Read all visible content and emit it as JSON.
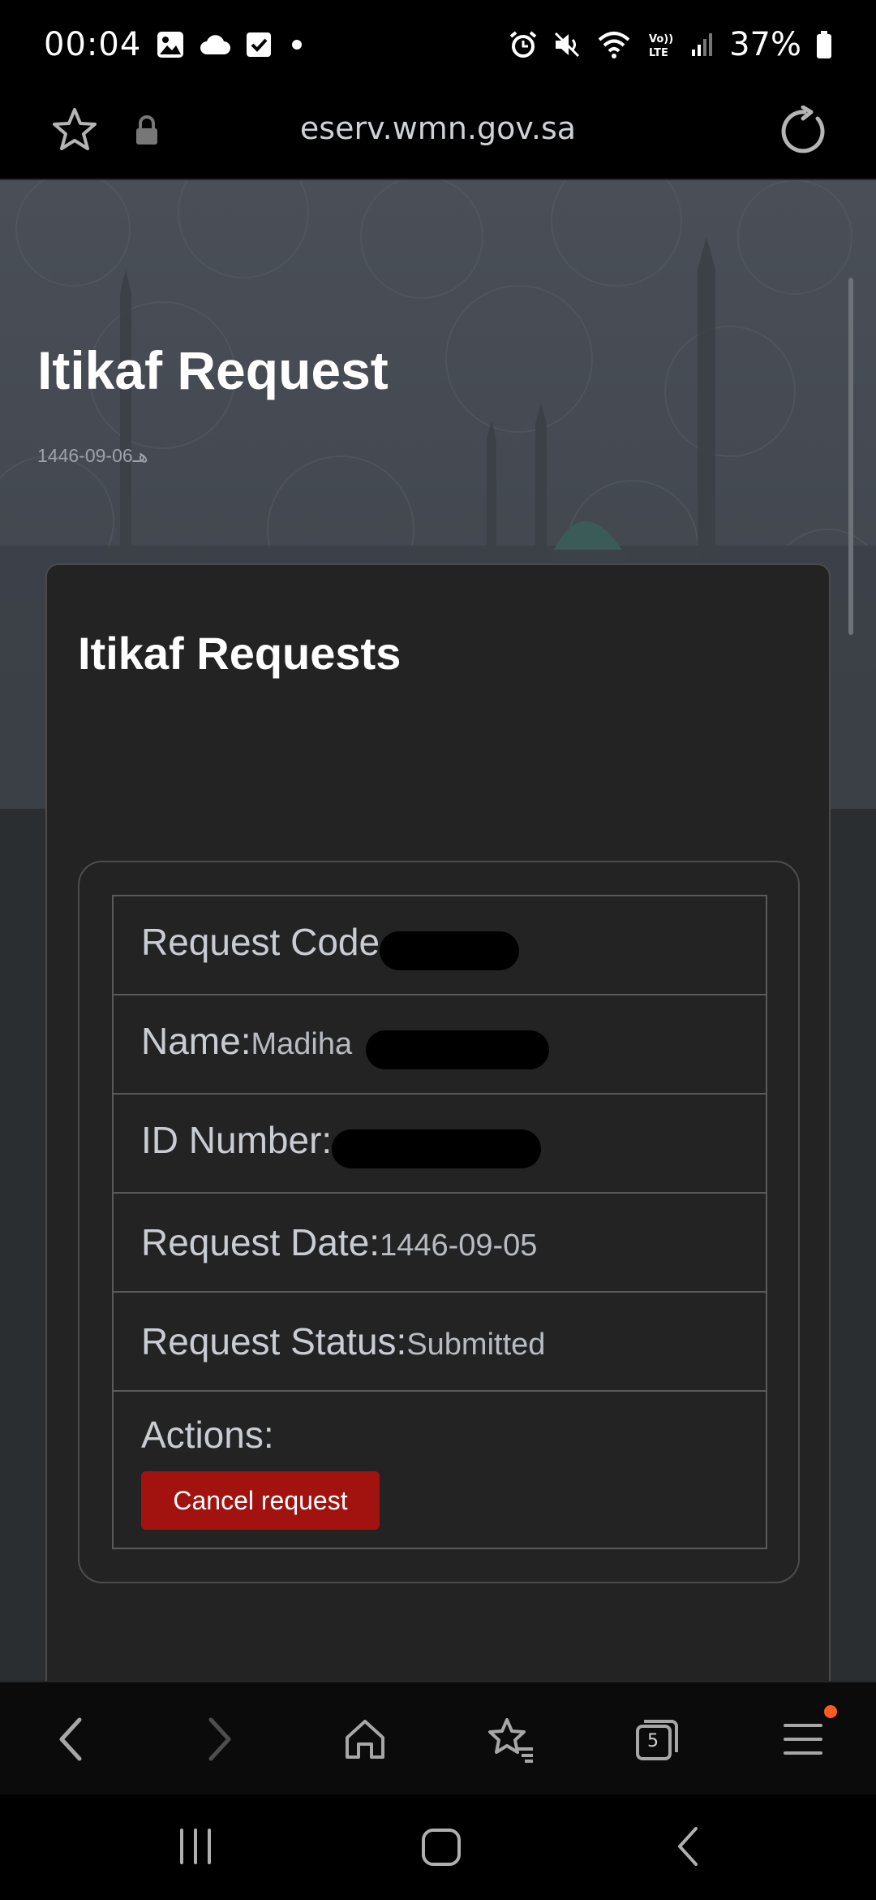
{
  "status_bar": {
    "time": "00:04",
    "battery": "37%",
    "left_icons": [
      "image-icon",
      "cloud-icon",
      "checkbox-icon",
      "dot-icon"
    ],
    "right_icons": [
      "alarm-icon",
      "mute-icon",
      "wifi-icon",
      "volte-icon",
      "signal-icon",
      "battery-icon"
    ]
  },
  "browser": {
    "url": "eserv.wmn.gov.sa"
  },
  "hero": {
    "title": "Itikaf Request",
    "date": "1446-09-06هـ"
  },
  "card": {
    "title": "Itikaf Requests",
    "rows": {
      "request_code_label": "Request Code",
      "name_label": "Name:",
      "name_value": "Madiha",
      "id_number_label": "ID Number:",
      "request_date_label": "Request Date:",
      "request_date_value": "1446-09-05",
      "request_status_label": "Request Status:",
      "request_status_value": "Submitted",
      "actions_label": "Actions:"
    },
    "cancel_button_label": "Cancel request"
  },
  "toolbar": {
    "tabs_count": "5",
    "menu_badge_color": "#ff5a1f"
  },
  "colors": {
    "cancel_button": "#a2120f",
    "card_background": "#232323",
    "hero_background": "#454a52"
  }
}
